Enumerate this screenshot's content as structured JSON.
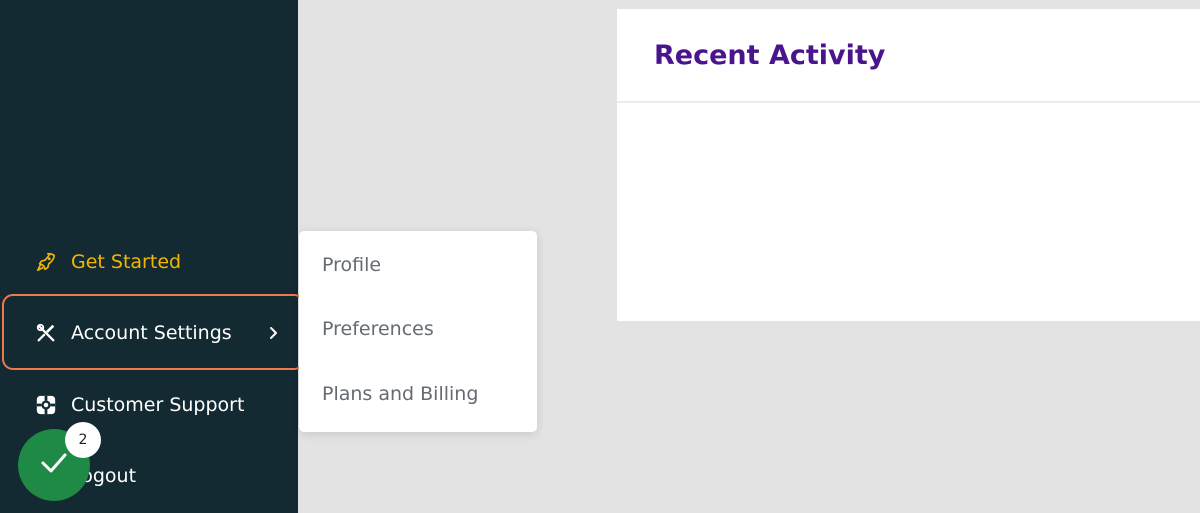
{
  "sidebar": {
    "items": [
      {
        "label": "Get Started",
        "icon": "rocket-icon"
      },
      {
        "label": "Account Settings",
        "icon": "tools-icon"
      },
      {
        "label": "Customer Support",
        "icon": "support-icon"
      },
      {
        "label": "Logout",
        "icon": "logout-icon"
      }
    ],
    "active_color": "#f2b705",
    "background": "#132a33"
  },
  "submenu": {
    "items": [
      {
        "label": "Profile"
      },
      {
        "label": "Preferences"
      },
      {
        "label": "Plans and Billing"
      }
    ]
  },
  "main": {
    "card": {
      "title": "Recent Activity",
      "title_color": "#4a148c"
    }
  },
  "checklist_button": {
    "icon": "check-icon",
    "badge_count": "2",
    "color": "#1e8a45"
  },
  "highlight_color": "#f07850"
}
